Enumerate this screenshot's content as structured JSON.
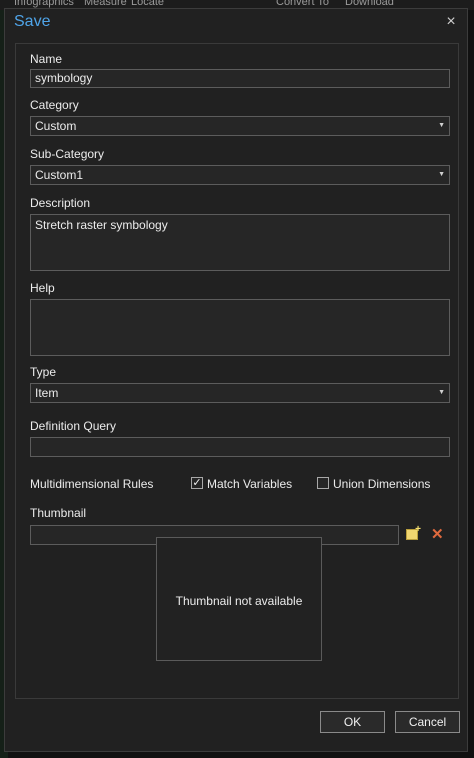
{
  "background": {
    "ribbon_items": [
      "Infographics",
      "Measure",
      "Locate",
      "Convert To",
      "Download"
    ]
  },
  "dialog": {
    "title": "Save",
    "close_glyph": "×"
  },
  "form": {
    "name": {
      "label": "Name",
      "value": "symbology"
    },
    "category": {
      "label": "Category",
      "value": "Custom"
    },
    "subcategory": {
      "label": "Sub-Category",
      "value": "Custom1"
    },
    "description": {
      "label": "Description",
      "value": "Stretch raster symbology"
    },
    "help": {
      "label": "Help",
      "value": ""
    },
    "type": {
      "label": "Type",
      "value": "Item"
    },
    "definition_query": {
      "label": "Definition Query",
      "value": ""
    },
    "multidimensional": {
      "label": "Multidimensional Rules",
      "match_variables": {
        "label": "Match Variables",
        "checked": true
      },
      "union_dimensions": {
        "label": "Union Dimensions",
        "checked": false
      }
    },
    "thumbnail": {
      "label": "Thumbnail",
      "value": "",
      "placeholder_text": "Thumbnail not available",
      "add_icon": "add-image-icon",
      "clear_icon": "clear-x-icon"
    }
  },
  "buttons": {
    "ok": "OK",
    "cancel": "Cancel"
  },
  "colors": {
    "title": "#4fa4e8",
    "clear_icon": "#e06a3e",
    "add_icon": "#f0d670"
  }
}
